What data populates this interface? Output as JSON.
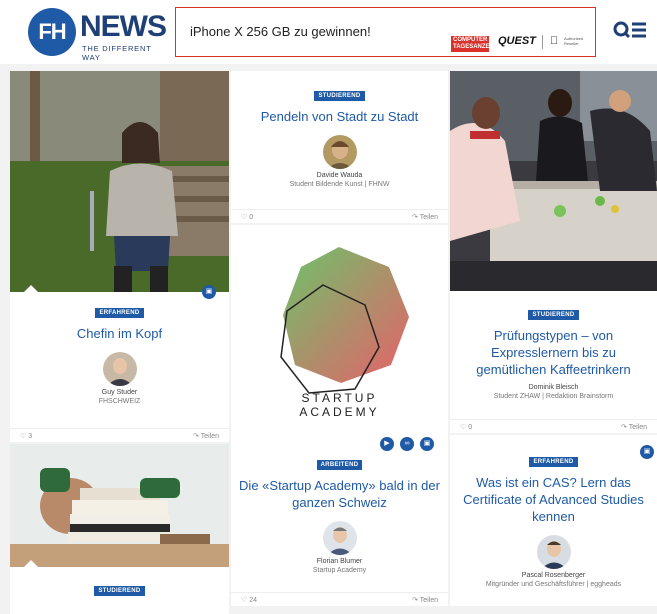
{
  "header": {
    "logo_mark": "FH",
    "logo_word": "NEWS",
    "logo_tagline": "THE DIFFERENT WAY",
    "ad_text": "iPhone X 256 GB zu gewinnen!",
    "ad_brand_1": "COMPUTER TAGESANZEIGER",
    "ad_brand_2": "QUEST",
    "ad_brand_3": "",
    "ad_brand_3_sub": "Authorised Reseller"
  },
  "cards": {
    "chefin": {
      "badge": "ERFAHREND",
      "title": "Chefin im Kopf",
      "author": "Guy Studer",
      "role": "FHSCHWEIZ",
      "likes": "3",
      "share": "Teilen"
    },
    "pendeln": {
      "badge": "STUDIEREND",
      "title": "Pendeln von Stadt zu Stadt",
      "author": "Davide Wauda",
      "role": "Student Bildende Kunst | FHNW",
      "likes": "0",
      "share": "Teilen"
    },
    "startup_logo": {
      "line1": "STARTUP",
      "line2": "ACADEMY"
    },
    "startup": {
      "badge": "ARBEITEND",
      "title": "Die «Startup Academy» bald in der ganzen Schweiz",
      "author": "Florian Blumer",
      "role": "Startup Academy",
      "likes": "24",
      "share": "Teilen"
    },
    "pruefung": {
      "badge": "STUDIEREND",
      "title": "Prüfungstypen – von Expresslernern bis zu gemütlichen Kaffeetrinkern",
      "author": "Dominik Bleisch",
      "role": "Student ZHAW | Redaktion Brainstorm",
      "likes": "0",
      "share": "Teilen"
    },
    "cas": {
      "badge": "ERFAHREND",
      "title": "Was ist ein CAS? Lern das Certificate of Advanced Studies kennen",
      "author": "Pascal Rosenberger",
      "role": "Mitgründer und Geschäftsführer | eggheads"
    },
    "books": {
      "badge": "STUDIEREND"
    }
  },
  "colors": {
    "brand_blue": "#1f5aa6",
    "ad_red": "#d9302a"
  }
}
